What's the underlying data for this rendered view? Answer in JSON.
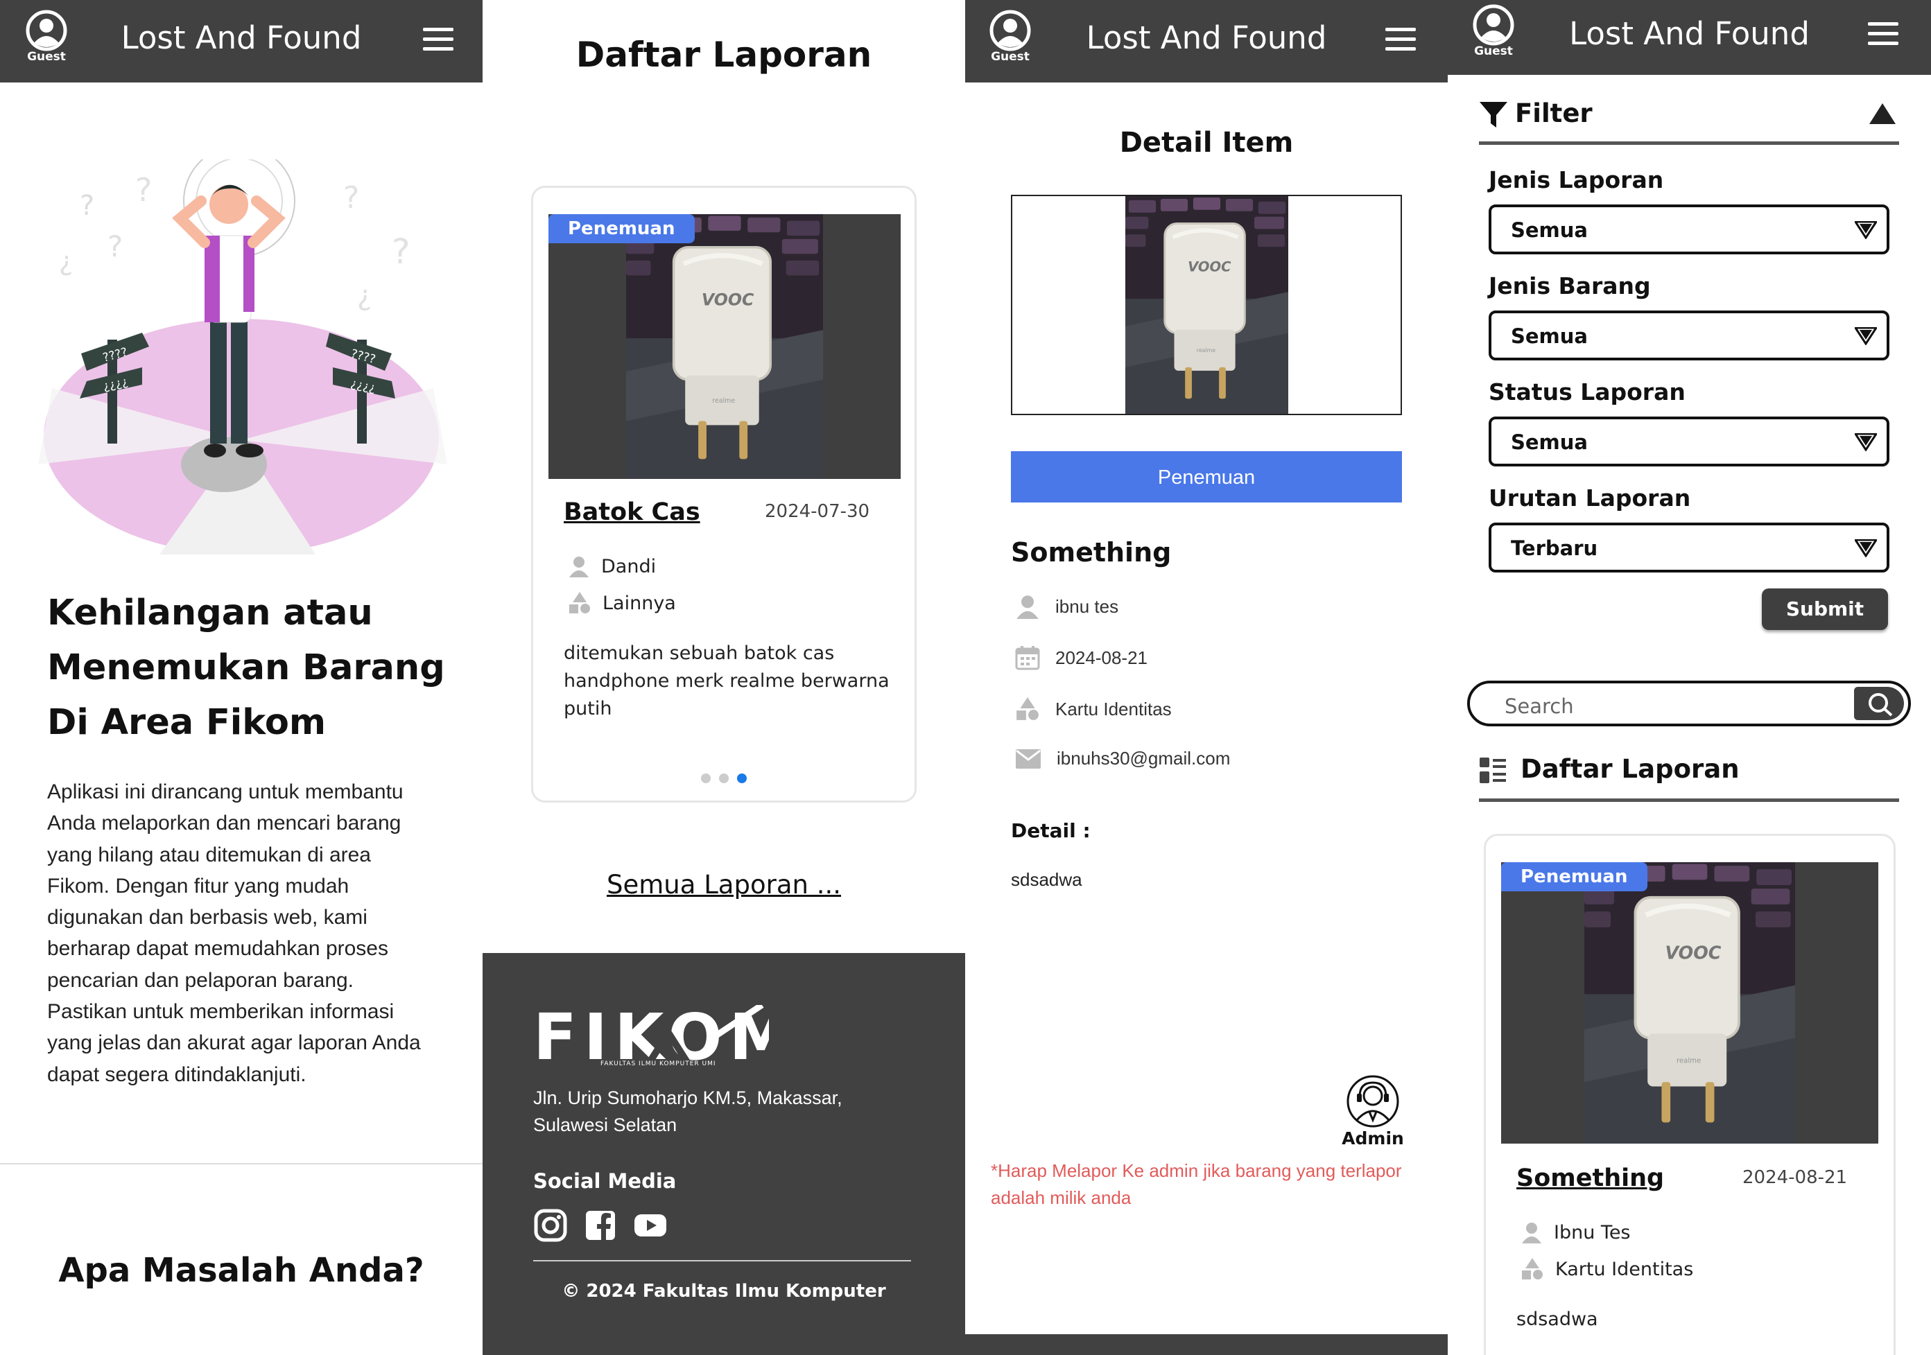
{
  "navbar": {
    "guest_label": "Guest",
    "title": "Lost And Found"
  },
  "home": {
    "hero_title": "Kehilangan atau Menemukan Barang Di Area Fikom",
    "hero_description": "Aplikasi ini dirancang untuk membantu Anda melaporkan dan mencari barang yang hilang atau ditemukan di area Fikom. Dengan fitur yang mudah digunakan dan berbasis web, kami berharap dapat memudahkan proses pencarian dan pelaporan barang. Pastikan untuk memberikan informasi yang jelas dan akurat agar laporan Anda dapat segera ditindaklanjuti.",
    "problem_title": "Apa Masalah Anda?",
    "illustration_marks": {
      "sign_left_top": "????",
      "sign_left_bottom": "¿¿¿¿",
      "sign_right_top": "????",
      "sign_right_bottom": "¿¿¿¿"
    }
  },
  "report_list": {
    "title": "Daftar Laporan",
    "card": {
      "badge": "Penemuan",
      "name": "Batok Cas",
      "date": "2024-07-30",
      "reporter": "Dandi",
      "category": "Lainnya",
      "description": "ditemukan sebuah batok cas handphone merk realme berwarna putih",
      "carousel": {
        "total": 3,
        "active_index": 2
      }
    },
    "all_link": "Semua Laporan ..."
  },
  "footer": {
    "logo_text": "FIKOM",
    "logo_subtext": "FAKULTAS ILMU KOMPUTER UMI",
    "address": "Jln. Urip Sumoharjo KM.5, Makassar, Sulawesi Selatan",
    "social_title": "Social Media",
    "social_icons": [
      "instagram-icon",
      "facebook-icon",
      "youtube-icon"
    ],
    "copyright": "© 2024 Fakultas Ilmu Komputer"
  },
  "detail": {
    "title": "Detail Item",
    "type_button": "Penemuan",
    "name": "Something",
    "reporter": "ibnu tes",
    "date": "2024-08-21",
    "category": "Kartu Identitas",
    "email": "ibnuhs30@gmail.com",
    "detail_label": "Detail :",
    "detail_text": "sdsadwa",
    "admin_label": "Admin",
    "warning": "*Harap Melapor Ke admin jika barang yang terlapor adalah milik anda"
  },
  "filter": {
    "title": "Filter",
    "fields": [
      {
        "label": "Jenis Laporan",
        "value": "Semua"
      },
      {
        "label": "Jenis Barang",
        "value": "Semua"
      },
      {
        "label": "Status Laporan",
        "value": "Semua"
      },
      {
        "label": "Urutan Laporan",
        "value": "Terbaru"
      }
    ],
    "submit": "Submit",
    "search_placeholder": "Search",
    "list_title": "Daftar Laporan",
    "card": {
      "badge": "Penemuan",
      "name": "Something",
      "date": "2024-08-21",
      "reporter": "Ibnu Tes",
      "category": "Kartu Identitas",
      "description": "sdsadwa"
    }
  },
  "photo": {
    "brand_text": "VOOC",
    "sub_text": "realme"
  },
  "colors": {
    "navbar": "#414141",
    "accent_blue": "#4a78e8",
    "warning_red": "#e15b5b",
    "active_dot": "#1a7ae8"
  }
}
